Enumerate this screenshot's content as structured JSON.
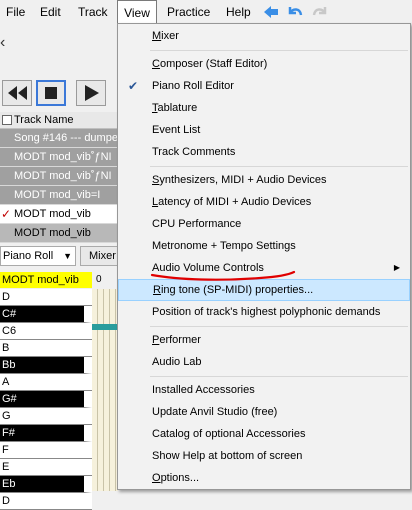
{
  "menubar": {
    "file": "File",
    "edit": "Edit",
    "track": "Track",
    "view": "View",
    "practice": "Practice",
    "help": "Help"
  },
  "toolbar_icons": [
    "back-arrow-icon",
    "undo-icon",
    "redo-icon"
  ],
  "transport": {
    "icons": [
      "rewind-icon",
      "stop-icon",
      "play-icon"
    ]
  },
  "tracks": {
    "header": "Track Name",
    "rows": [
      "Song #146 --- dumpe",
      "MODT mod_vib˚ƒNI",
      "MODT mod_vib˚ƒNI",
      "MODT mod_vib=I",
      "MODT mod_vib",
      "MODT mod_vib"
    ]
  },
  "pianoroll": {
    "select": "Piano Roll",
    "mixer_tab": "Mixer",
    "track_label": "MODT mod_vib",
    "track_right": "0"
  },
  "keys": [
    "D",
    "C#",
    "C6",
    "B",
    "Bb",
    "A",
    "G#",
    "G",
    "F#",
    "F",
    "E",
    "Eb",
    "D"
  ],
  "view_menu": {
    "items": [
      {
        "label": "Mixer",
        "u": "M"
      },
      {
        "label": "Composer (Staff Editor)",
        "u": "C"
      },
      {
        "label": "Piano Roll Editor",
        "checked": "✔"
      },
      {
        "label": "Tablature",
        "u": "T"
      },
      {
        "label": "Event List"
      },
      {
        "label": "Track Comments"
      },
      {
        "label": "Synthesizers, MIDI + Audio Devices",
        "u": "S"
      },
      {
        "label": "Latency of MIDI + Audio Devices",
        "u": "L"
      },
      {
        "label": "CPU Performance"
      },
      {
        "label": "Metronome + Tempo Settings"
      },
      {
        "label": "Audio Volume Controls",
        "arrow": "▶"
      },
      {
        "label": "Ring tone (SP-MIDI) properties...",
        "u": "R"
      },
      {
        "label": "Position of track's highest polyphonic demands"
      },
      {
        "label": "Performer",
        "u": "P"
      },
      {
        "label": "Audio Lab"
      },
      {
        "label": "Installed Accessories"
      },
      {
        "label": "Update Anvil Studio (free)"
      },
      {
        "label": "Catalog of optional Accessories"
      },
      {
        "label": "Show Help at bottom of screen"
      },
      {
        "label": "Options...",
        "u": "O"
      }
    ]
  },
  "colors": {
    "highlight": "#cce8ff",
    "track_yellow": "#ffff00",
    "annotation": "#e00000",
    "note": "#2a9d9d"
  }
}
